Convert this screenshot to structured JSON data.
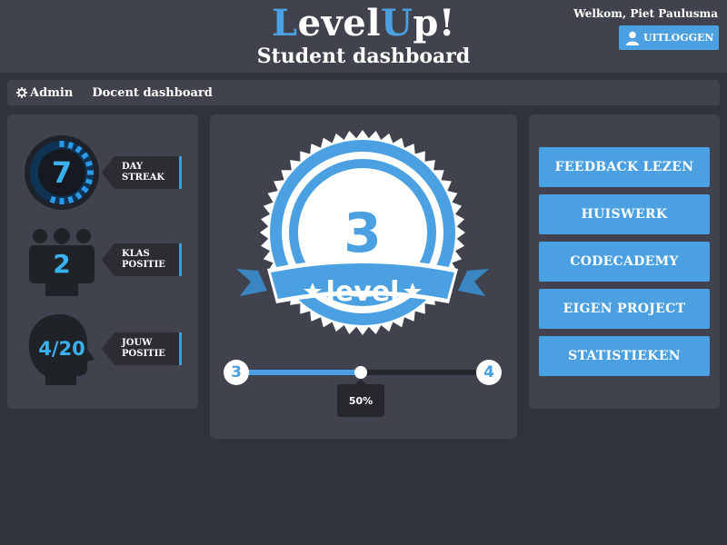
{
  "header": {
    "logo": {
      "l1": "L",
      "l2": "evel",
      "l3": "U",
      "l4": "p!"
    },
    "subtitle": "Student dashboard",
    "welcome": "Welkom, Piet Paulusma",
    "logout_label": "UITLOGGEN",
    "logout_icon": "user-icon"
  },
  "nav": {
    "admin_icon": "gear-icon",
    "items": [
      {
        "label": "Admin"
      },
      {
        "label": "Docent dashboard"
      }
    ]
  },
  "stats": [
    {
      "value": "7",
      "line1": "DAY",
      "line2": "STREAK",
      "icon": "streak-ring-icon",
      "progress": 0.6
    },
    {
      "value": "2",
      "line1": "KLAS",
      "line2": "POSITIE",
      "icon": "group-people-icon"
    },
    {
      "value": "4/20",
      "line1": "JOUW",
      "line2": "POSITIE",
      "icon": "head-profile-icon"
    }
  ],
  "level": {
    "number": "3",
    "label": "level",
    "badge_icon": "level-badge-icon",
    "from": "3",
    "to": "4",
    "progress_percent": 50,
    "progress_label": "50%"
  },
  "menu": [
    {
      "label": "FEEDBACK LEZEN"
    },
    {
      "label": "HUISWERK"
    },
    {
      "label": "CODECADEMY"
    },
    {
      "label": "EIGEN PROJECT"
    },
    {
      "label": "STATISTIEKEN"
    }
  ],
  "colors": {
    "accent": "#4aa0e0",
    "stat_blue": "#3ab0ec",
    "panel": "#40434d",
    "background": "#30333d",
    "dark": "#26282d"
  }
}
